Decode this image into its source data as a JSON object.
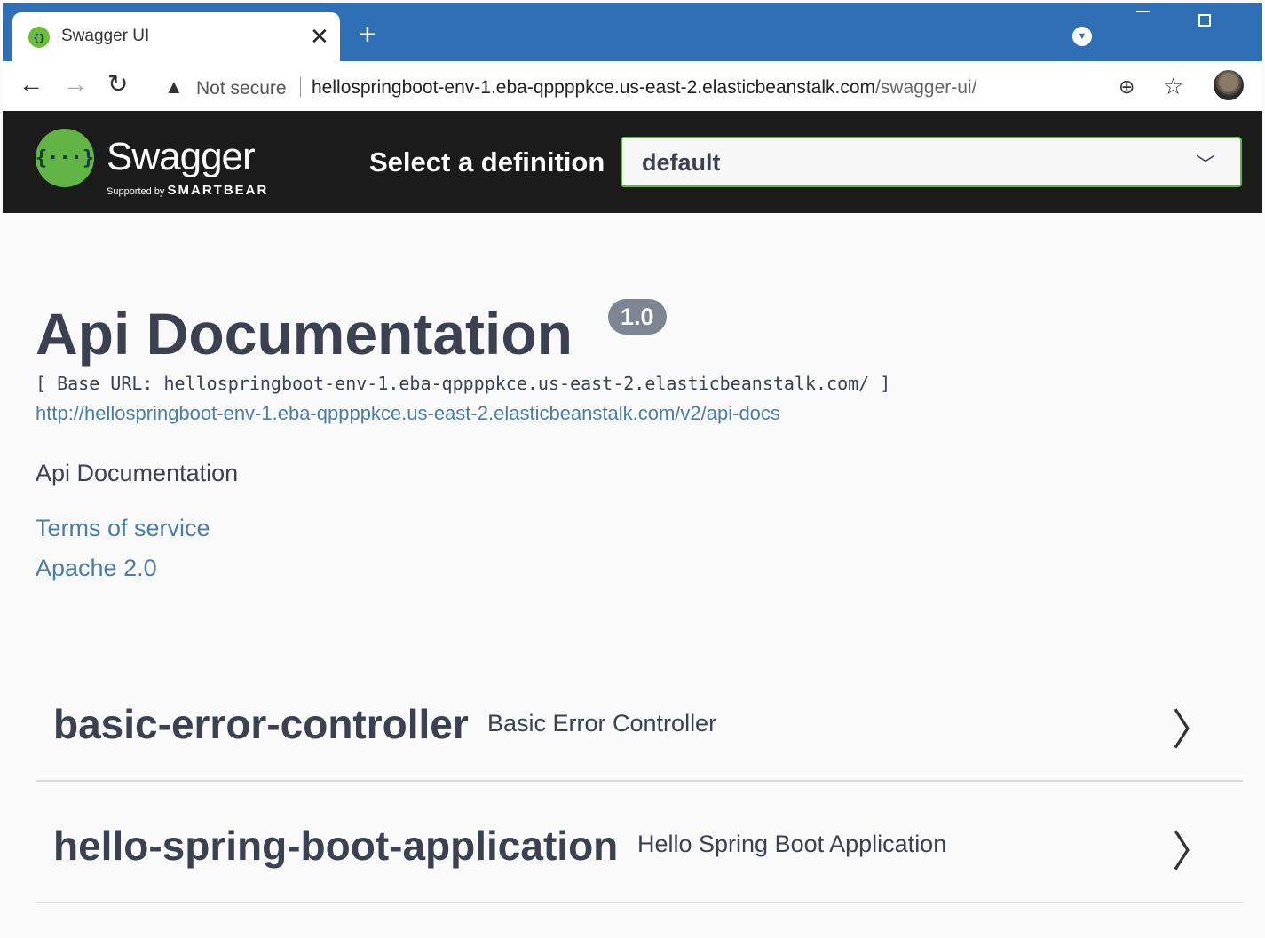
{
  "browser": {
    "tab_title": "Swagger UI",
    "not_secure": "Not secure",
    "url_host": "hellospringboot-env-1.eba-qppppkce.us-east-2.elasticbeanstalk.com",
    "url_path": "/swagger-ui/"
  },
  "swagger": {
    "logo_text": "Swagger",
    "supported_by": "Supported by",
    "smartbear": "SMARTBEAR",
    "select_label": "Select a definition",
    "definition": "default"
  },
  "info": {
    "title": "Api Documentation",
    "version": "1.0",
    "base_url": "[ Base URL: hellospringboot-env-1.eba-qppppkce.us-east-2.elasticbeanstalk.com/ ]",
    "api_docs_url": "http://hellospringboot-env-1.eba-qppppkce.us-east-2.elasticbeanstalk.com/v2/api-docs",
    "description": "Api Documentation",
    "terms": "Terms of service",
    "license": "Apache 2.0"
  },
  "tags": [
    {
      "name": "basic-error-controller",
      "description": "Basic Error Controller"
    },
    {
      "name": "hello-spring-boot-application",
      "description": "Hello Spring Boot Application"
    }
  ]
}
